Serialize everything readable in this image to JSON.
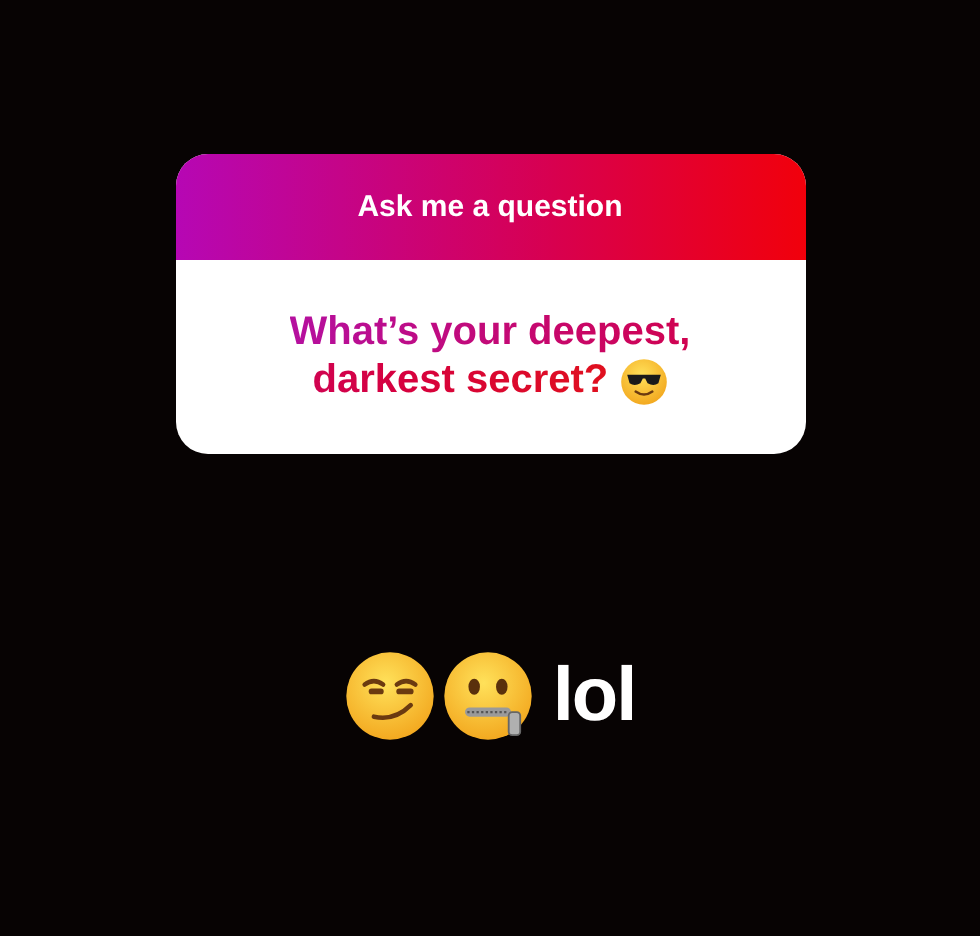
{
  "sticker": {
    "title": "Ask me a question",
    "question": "What’s your deepest, darkest secret?"
  },
  "reply": {
    "text": "lol"
  }
}
